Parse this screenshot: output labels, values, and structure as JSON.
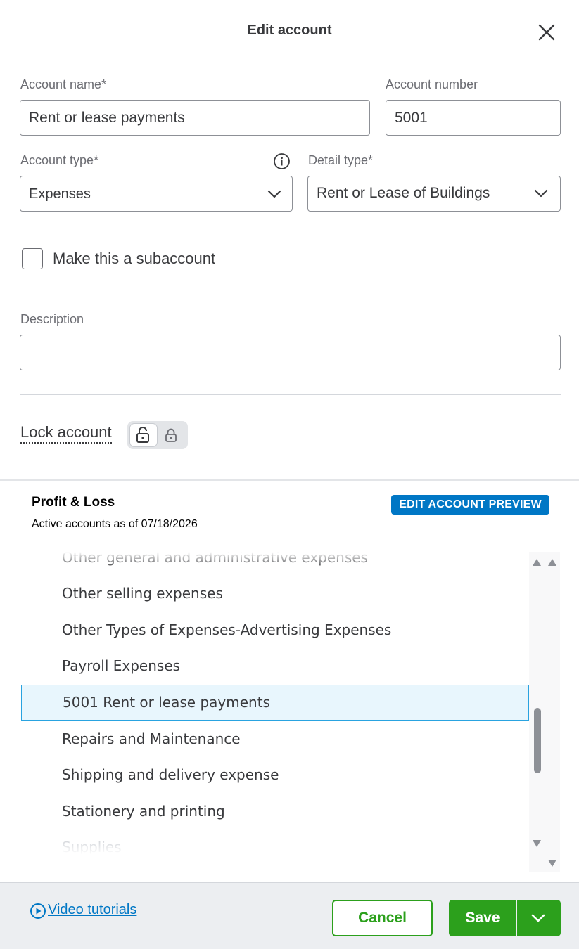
{
  "dialog": {
    "title": "Edit account",
    "close_icon": "close-icon"
  },
  "form": {
    "account_name": {
      "label": "Account name*",
      "value": "Rent or lease payments"
    },
    "account_number": {
      "label": "Account number",
      "value": "5001"
    },
    "account_type": {
      "label": "Account type*",
      "value": "Expenses",
      "info_icon": "info-icon"
    },
    "detail_type": {
      "label": "Detail type*",
      "value": "Rent or Lease of Buildings"
    },
    "subaccount": {
      "label": "Make this a subaccount",
      "checked": false
    },
    "description": {
      "label": "Description",
      "value": ""
    },
    "lock": {
      "label": "Lock account",
      "state": "unlocked"
    }
  },
  "preview": {
    "title": "Profit & Loss",
    "subtitle": "Active accounts as of 07/18/2026",
    "badge": "EDIT ACCOUNT PREVIEW",
    "items": [
      {
        "label": "Other general and administrative expenses"
      },
      {
        "label": "Other selling expenses"
      },
      {
        "label": "Other Types of Expenses-Advertising Expenses"
      },
      {
        "label": "Payroll Expenses"
      },
      {
        "label": "5001 Rent or lease payments",
        "selected": true
      },
      {
        "label": "Repairs and Maintenance"
      },
      {
        "label": "Shipping and delivery expense"
      },
      {
        "label": "Stationery and printing"
      },
      {
        "label": "Supplies"
      }
    ]
  },
  "footer": {
    "video_link": "Video tutorials",
    "cancel": "Cancel",
    "save": "Save"
  },
  "colors": {
    "brand_green": "#2ca01c",
    "link_blue": "#0077c5",
    "selected_bg": "#e8f6fd",
    "selected_border": "#29a3e0"
  }
}
